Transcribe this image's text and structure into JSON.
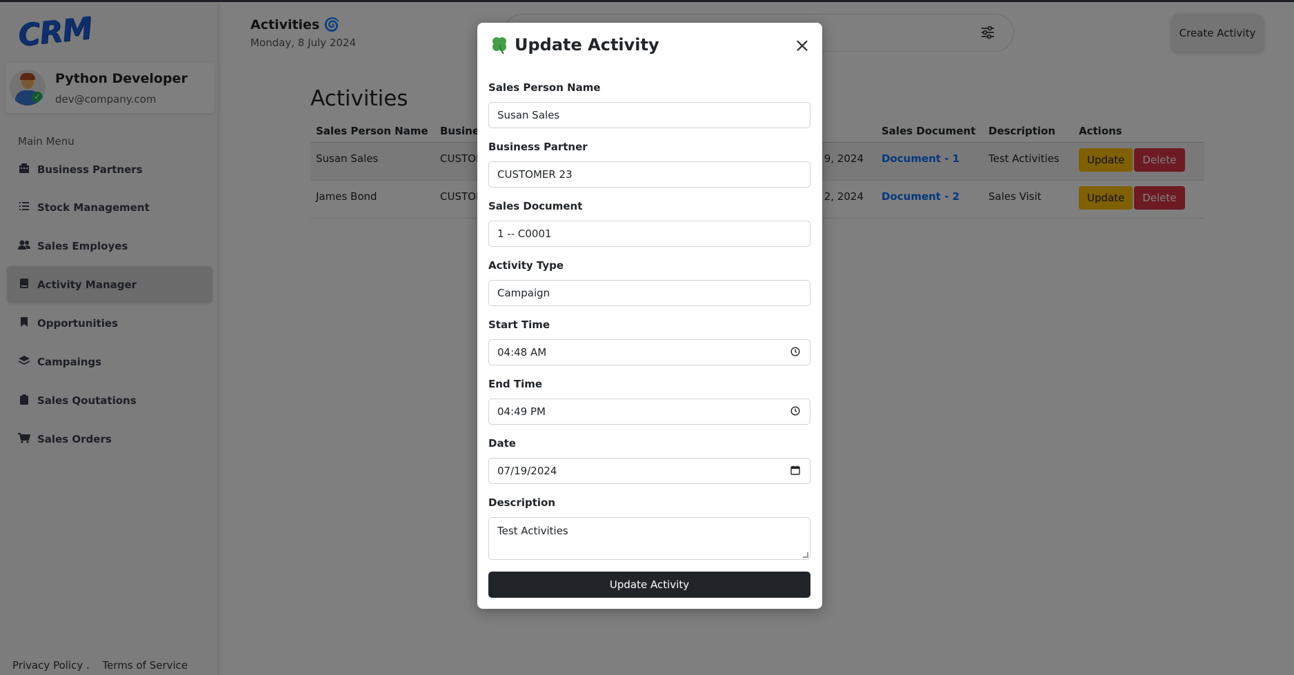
{
  "app": {
    "logo_text": "CRM",
    "profile": {
      "name": "Python Developer",
      "email": "dev@company.com"
    },
    "menu_title": "Main Menu",
    "nav": [
      {
        "label": "Business Partners",
        "icon": "building-icon"
      },
      {
        "label": "Stock Management",
        "icon": "list-icon"
      },
      {
        "label": "Sales Employes",
        "icon": "users-icon"
      },
      {
        "label": "Activity Manager",
        "icon": "book-icon",
        "active": true
      },
      {
        "label": "Opportunities",
        "icon": "bookmark-icon"
      },
      {
        "label": "Campaings",
        "icon": "layers-icon"
      },
      {
        "label": "Sales Qoutations",
        "icon": "clipboard-icon"
      },
      {
        "label": "Sales Orders",
        "icon": "cart-icon"
      }
    ],
    "footer": {
      "privacy": "Privacy Policy .",
      "terms": "Terms of Service"
    }
  },
  "header": {
    "title": "Activities",
    "title_icon": "🌀",
    "date": "Monday, 8 July 2024",
    "create_label": "Create Activity"
  },
  "content": {
    "title": "Activities",
    "columns": {
      "sales_person": "Sales Person Name",
      "business": "Busines",
      "sales_document": "Sales Document",
      "description": "Description",
      "actions": "Actions"
    },
    "rows": [
      {
        "sales_person": "Susan Sales",
        "business": "CUSTON",
        "date_tail": "9, 2024",
        "document": "Document - 1",
        "description": "Test Activities",
        "update": "Update",
        "delete": "Delete"
      },
      {
        "sales_person": "James Bond",
        "business": "CUSTON",
        "date_tail": "2, 2024",
        "document": "Document - 2",
        "description": "Sales Visit",
        "update": "Update",
        "delete": "Delete"
      }
    ]
  },
  "modal": {
    "title": "Update Activity",
    "close": "×",
    "fields": {
      "sales_person_label": "Sales Person Name",
      "sales_person_value": "Susan Sales",
      "business_partner_label": "Business Partner",
      "business_partner_value": "CUSTOMER 23",
      "sales_document_label": "Sales Document",
      "sales_document_value": "1 -- C0001",
      "activity_type_label": "Activity Type",
      "activity_type_value": "Campaign",
      "start_time_label": "Start Time",
      "start_time_value": "04:48 AM",
      "end_time_label": "End Time",
      "end_time_value": "04:49 PM",
      "date_label": "Date",
      "date_value": "07/19/2024",
      "description_label": "Description",
      "description_value": "Test Activities"
    },
    "submit_label": "Update Activity"
  },
  "colors": {
    "update_button": "#ffc107",
    "delete_button": "#dc3545",
    "link": "#0d6efd",
    "submit_button": "#212529",
    "logo": "#1f5fd6"
  }
}
